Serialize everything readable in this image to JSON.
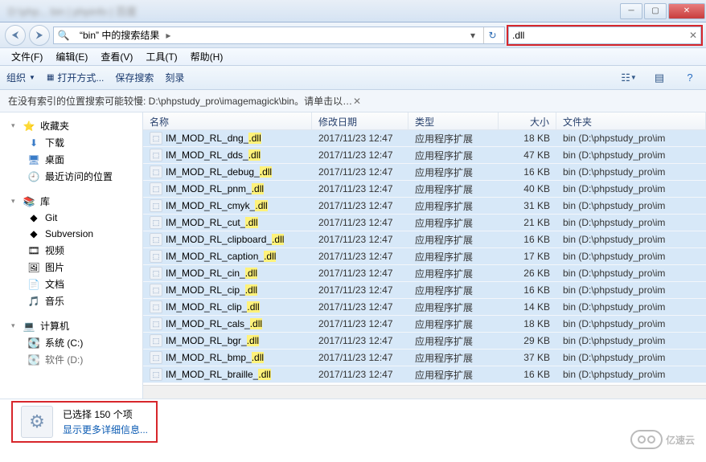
{
  "window": {
    "title_blur": "D:\\php... bin | phpinfo | 百度"
  },
  "nav": {
    "breadcrumb": "“bin” 中的搜索结果",
    "search_value": ".dll"
  },
  "menu": {
    "file": "文件(F)",
    "edit": "编辑(E)",
    "view": "查看(V)",
    "tools": "工具(T)",
    "help": "帮助(H)"
  },
  "toolbar": {
    "organize": "组织",
    "open_with": "打开方式...",
    "save_search": "保存搜索",
    "burn": "刻录"
  },
  "infobar": "在没有索引的位置搜索可能较慢: D:\\phpstudy_pro\\imagemagick\\bin。请单击以添加到索引...",
  "sidebar": {
    "favorites": {
      "label": "收藏夹",
      "items": [
        "下载",
        "桌面",
        "最近访问的位置"
      ]
    },
    "libraries": {
      "label": "库",
      "items": [
        "Git",
        "Subversion",
        "视频",
        "图片",
        "文档",
        "音乐"
      ]
    },
    "computer": {
      "label": "计算机",
      "items": [
        "系统 (C:)"
      ]
    },
    "partial": "软件 (D:)"
  },
  "columns": {
    "name": "名称",
    "date": "修改日期",
    "type": "类型",
    "size": "大小",
    "folder": "文件夹"
  },
  "type_label": "应用程序扩展",
  "folder_label": "bin (D:\\phpstudy_pro\\im",
  "files": [
    {
      "name_pre": "IM_MOD_RL_dng_",
      "ext": ".dll",
      "date": "2017/11/23 12:47",
      "size": "18 KB"
    },
    {
      "name_pre": "IM_MOD_RL_dds_",
      "ext": ".dll",
      "date": "2017/11/23 12:47",
      "size": "47 KB"
    },
    {
      "name_pre": "IM_MOD_RL_debug_",
      "ext": ".dll",
      "date": "2017/11/23 12:47",
      "size": "16 KB"
    },
    {
      "name_pre": "IM_MOD_RL_pnm_",
      "ext": ".dll",
      "date": "2017/11/23 12:47",
      "size": "40 KB"
    },
    {
      "name_pre": "IM_MOD_RL_cmyk_",
      "ext": ".dll",
      "date": "2017/11/23 12:47",
      "size": "31 KB"
    },
    {
      "name_pre": "IM_MOD_RL_cut_",
      "ext": ".dll",
      "date": "2017/11/23 12:47",
      "size": "21 KB"
    },
    {
      "name_pre": "IM_MOD_RL_clipboard_",
      "ext": ".dll",
      "date": "2017/11/23 12:47",
      "size": "16 KB"
    },
    {
      "name_pre": "IM_MOD_RL_caption_",
      "ext": ".dll",
      "date": "2017/11/23 12:47",
      "size": "17 KB"
    },
    {
      "name_pre": "IM_MOD_RL_cin_",
      "ext": ".dll",
      "date": "2017/11/23 12:47",
      "size": "26 KB"
    },
    {
      "name_pre": "IM_MOD_RL_cip_",
      "ext": ".dll",
      "date": "2017/11/23 12:47",
      "size": "16 KB"
    },
    {
      "name_pre": "IM_MOD_RL_clip_",
      "ext": ".dll",
      "date": "2017/11/23 12:47",
      "size": "14 KB"
    },
    {
      "name_pre": "IM_MOD_RL_cals_",
      "ext": ".dll",
      "date": "2017/11/23 12:47",
      "size": "18 KB"
    },
    {
      "name_pre": "IM_MOD_RL_bgr_",
      "ext": ".dll",
      "date": "2017/11/23 12:47",
      "size": "29 KB"
    },
    {
      "name_pre": "IM_MOD_RL_bmp_",
      "ext": ".dll",
      "date": "2017/11/23 12:47",
      "size": "37 KB"
    },
    {
      "name_pre": "IM_MOD_RL_braille_",
      "ext": ".dll",
      "date": "2017/11/23 12:47",
      "size": "16 KB"
    }
  ],
  "status": {
    "selected": "已选择 150 个项",
    "more": "显示更多详细信息..."
  },
  "watermark": "亿速云"
}
